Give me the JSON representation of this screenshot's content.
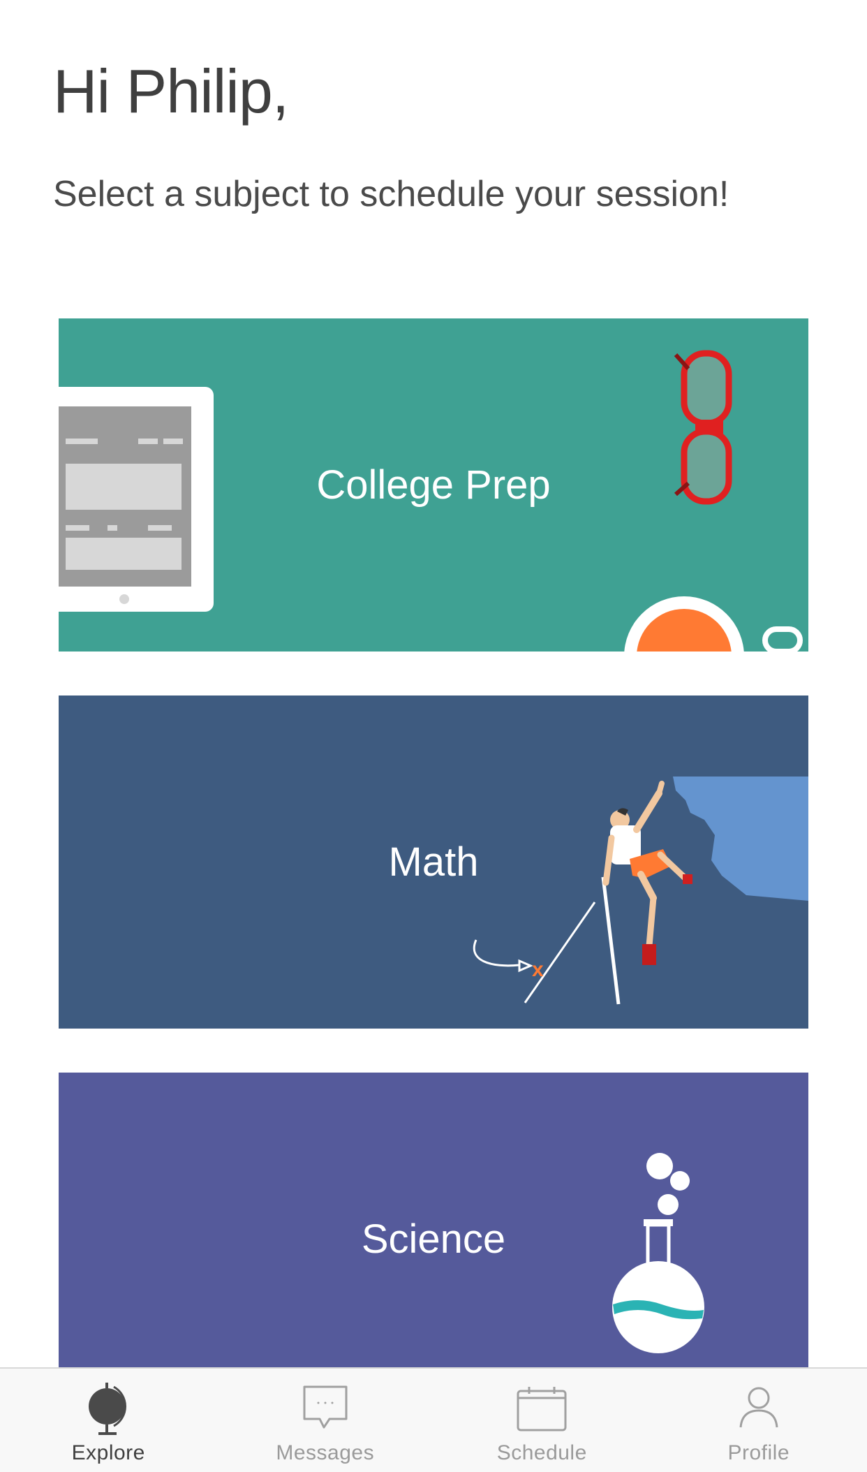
{
  "header": {
    "greeting": "Hi Philip,",
    "subtitle": "Select a subject to schedule your session!"
  },
  "subjects": [
    {
      "label": "College Prep",
      "color": "#3fa193"
    },
    {
      "label": "Math",
      "color": "#3e5b80"
    },
    {
      "label": "Science",
      "color": "#555a9b"
    }
  ],
  "tabbar": {
    "tabs": [
      {
        "label": "Explore",
        "icon": "globe-icon",
        "active": true
      },
      {
        "label": "Messages",
        "icon": "chat-bubble-icon",
        "active": false
      },
      {
        "label": "Schedule",
        "icon": "calendar-icon",
        "active": false
      },
      {
        "label": "Profile",
        "icon": "person-icon",
        "active": false
      }
    ]
  },
  "colors": {
    "accent_orange": "#ff7a33",
    "glasses_red": "#e02020",
    "tab_active": "#3f3f3f",
    "tab_inactive": "#9a9a9a"
  }
}
